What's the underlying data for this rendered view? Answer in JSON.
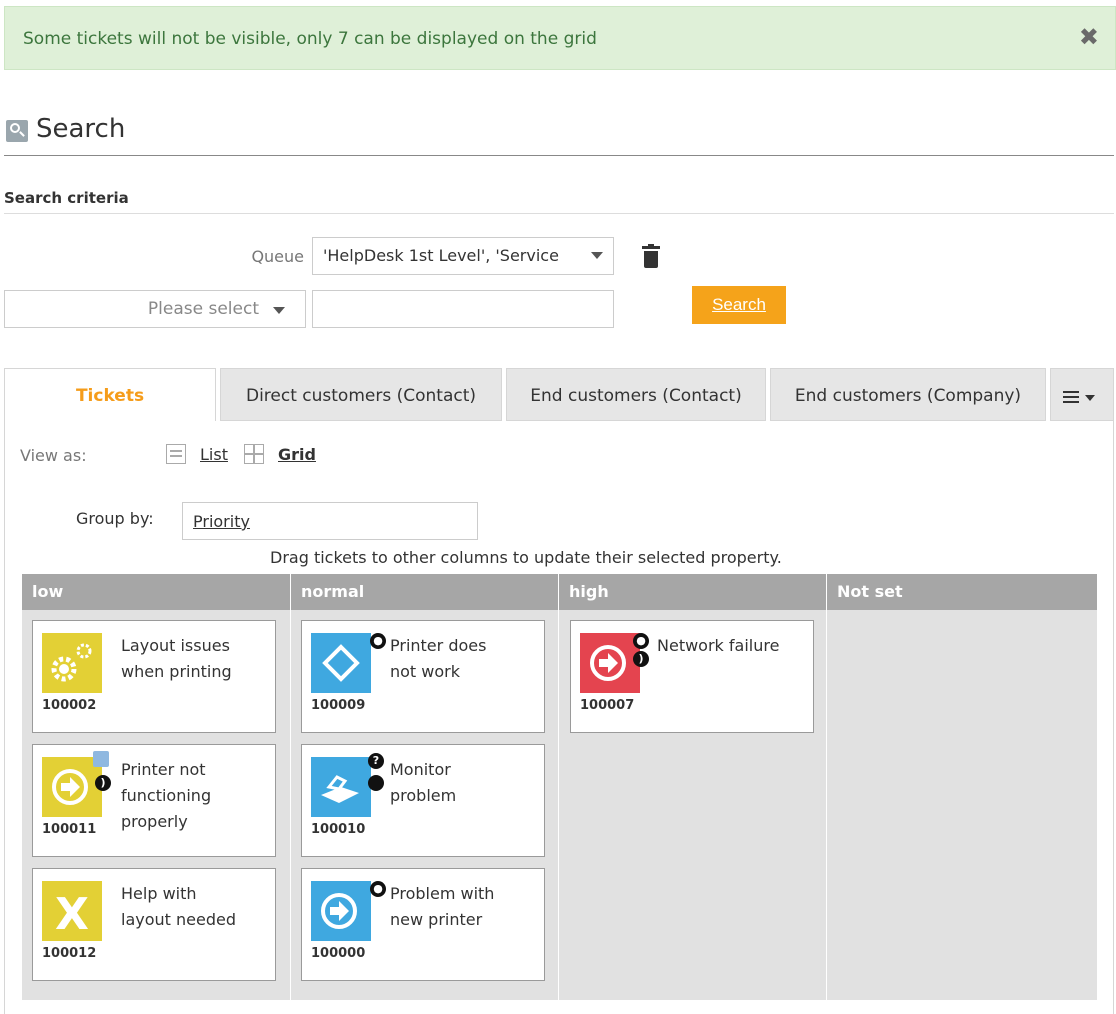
{
  "banner": {
    "message": "Some tickets will not be visible, only 7 can be displayed on the grid",
    "close_glyph": "✖"
  },
  "search": {
    "title": "Search",
    "criteria_label": "Search criteria",
    "queue_label": "Queue",
    "queue_value": "'HelpDesk 1st Level', 'Service",
    "property_placeholder": "Please select",
    "search_button": "Search"
  },
  "tabs": [
    {
      "label": "Tickets"
    },
    {
      "label": "Direct customers (Contact)"
    },
    {
      "label": "End customers (Contact)"
    },
    {
      "label": "End customers (Company)"
    }
  ],
  "view": {
    "label": "View as:",
    "list": "List",
    "grid": "Grid"
  },
  "groupby": {
    "label": "Group by:",
    "value": "Priority"
  },
  "hint": "Drag tickets to other columns to update their selected property.",
  "columns": [
    {
      "header": "low"
    },
    {
      "header": "normal"
    },
    {
      "header": "high"
    },
    {
      "header": "Not set"
    }
  ],
  "tickets": {
    "t100002": {
      "number": "100002",
      "line1": "Layout issues",
      "line2": "when printing",
      "icon": "gear-icon",
      "color": "#e3d035"
    },
    "t100011": {
      "number": "100011",
      "line1": "Printer not",
      "line2": "functioning",
      "line3": "properly",
      "icon": "arrow-circle-icon",
      "color": "#e3d035"
    },
    "t100012": {
      "number": "100012",
      "line1": "Help with",
      "line2": "layout needed",
      "icon": "x-icon",
      "color": "#e3d035"
    },
    "t100009": {
      "number": "100009",
      "line1": "Printer does",
      "line2": "not work",
      "icon": "diamond-icon",
      "color": "#3fa8e0"
    },
    "t100010": {
      "number": "100010",
      "line1": "Monitor",
      "line2": "problem",
      "icon": "phone-icon",
      "color": "#3fa8e0"
    },
    "t100000": {
      "number": "100000",
      "line1": "Problem with",
      "line2": "new printer",
      "icon": "arrow-circle-icon",
      "color": "#3fa8e0"
    },
    "t100007": {
      "number": "100007",
      "line1": "Network failure",
      "icon": "arrow-circle-icon",
      "color": "#e4444f"
    }
  }
}
